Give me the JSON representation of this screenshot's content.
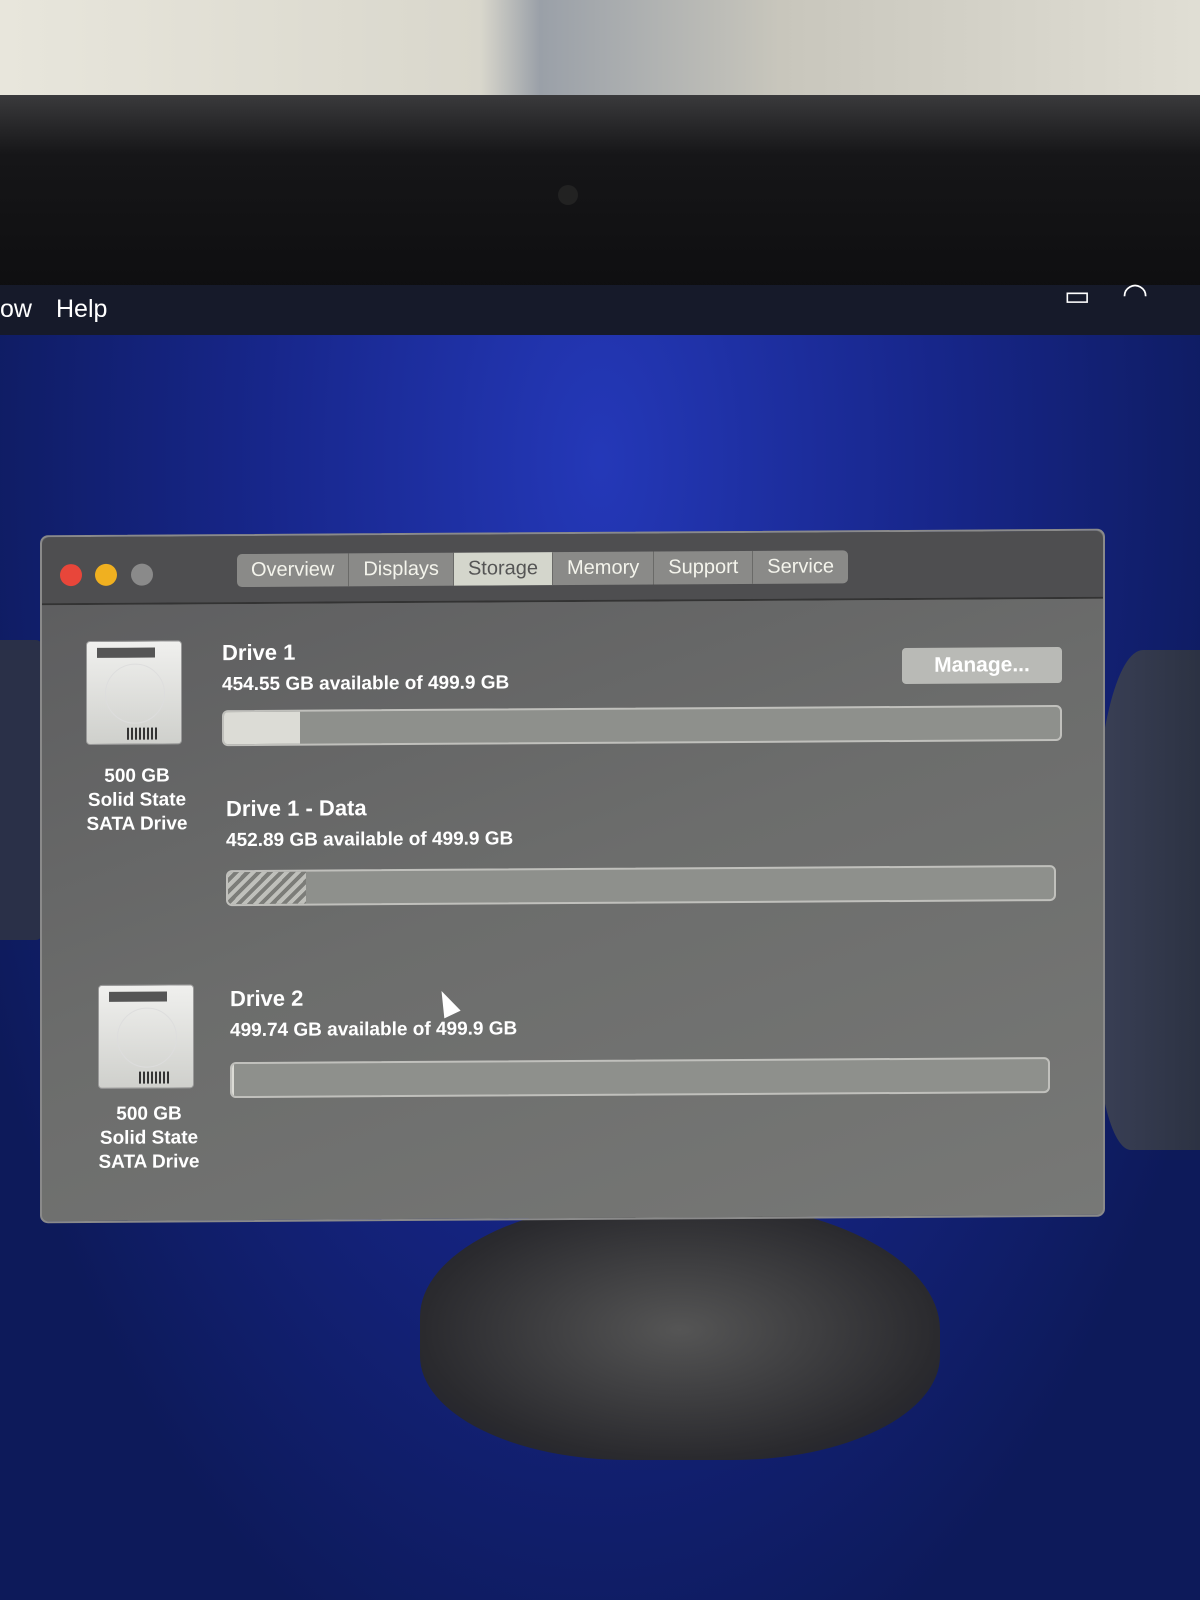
{
  "menubar": {
    "items": [
      "ow",
      "Help"
    ],
    "icons": [
      "airplay-icon",
      "wifi-icon"
    ]
  },
  "window": {
    "tabs": [
      {
        "label": "Overview"
      },
      {
        "label": "Displays"
      },
      {
        "label": "Storage",
        "selected": true
      },
      {
        "label": "Memory"
      },
      {
        "label": "Support"
      },
      {
        "label": "Service"
      }
    ],
    "manage_label": "Manage...",
    "devices": [
      {
        "caption": [
          "500 GB",
          "Solid State",
          "SATA Drive"
        ],
        "volumes": [
          {
            "name": "Drive 1",
            "available": "454.55 GB available of 499.9 GB",
            "used_fraction": 0.091
          },
          {
            "name": "Drive 1 - Data",
            "available": "452.89 GB available of 499.9 GB",
            "used_fraction": 0.094
          }
        ]
      },
      {
        "caption": [
          "500 GB",
          "Solid State",
          "SATA Drive"
        ],
        "volumes": [
          {
            "name": "Drive 2",
            "available": "499.74 GB available of 499.9 GB",
            "used_fraction": 0.0003
          }
        ]
      }
    ]
  },
  "colors": {
    "close": "#e8463a",
    "minimize": "#f0b020",
    "zoom": "#8a8a8a"
  }
}
